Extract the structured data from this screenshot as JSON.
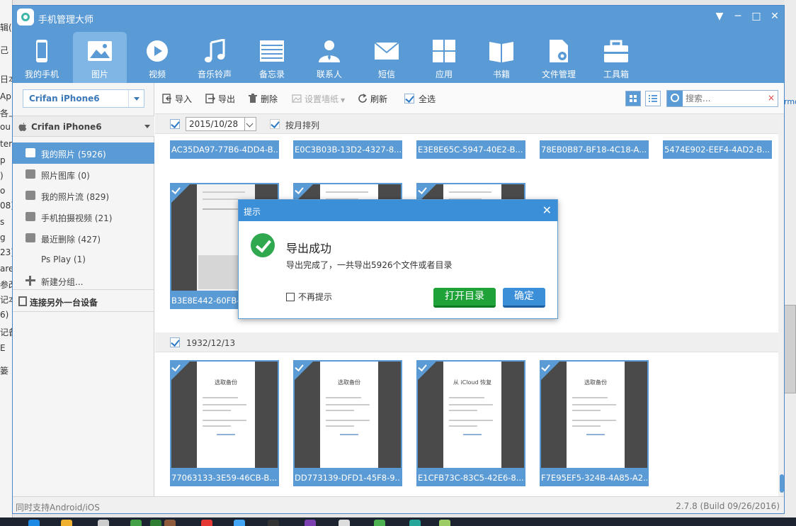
{
  "background": {
    "left_fragments": [
      "辑(",
      "己",
      "日本",
      "Ap",
      "各上",
      "ou",
      "ter",
      "p",
      ")",
      "o",
      "08)",
      "s",
      "g",
      "23)",
      "are",
      "参改",
      "记本",
      "6)",
      "记备",
      "E",
      "篓"
    ],
    "right_fragment": "rmo"
  },
  "titlebar": {
    "title": "手机管理大师",
    "menu_glyph": "▼",
    "minimize_glyph": "─",
    "maximize_glyph": "□",
    "close_glyph": "✕"
  },
  "nav": {
    "items": [
      {
        "label": "我的手机",
        "icon": "phone-icon"
      },
      {
        "label": "图片",
        "icon": "picture-icon"
      },
      {
        "label": "视频",
        "icon": "video-icon"
      },
      {
        "label": "音乐铃声",
        "icon": "music-icon"
      },
      {
        "label": "备忘录",
        "icon": "memo-icon"
      },
      {
        "label": "联系人",
        "icon": "contact-icon"
      },
      {
        "label": "短信",
        "icon": "message-icon"
      },
      {
        "label": "应用",
        "icon": "apps-icon"
      },
      {
        "label": "书籍",
        "icon": "book-icon"
      },
      {
        "label": "文件管理",
        "icon": "file-manager-icon"
      },
      {
        "label": "工具箱",
        "icon": "toolbox-icon"
      }
    ],
    "active_index": 1,
    "color": "#5b9bd5"
  },
  "sidebar": {
    "device_select_value": "Crifan iPhone6",
    "device_header": "Crifan iPhone6",
    "items": [
      {
        "label": "我的照片 (5926)",
        "icon": "photo-icon"
      },
      {
        "label": "照片图库 (0)",
        "icon": "gallery-icon"
      },
      {
        "label": "我的照片流 (829)",
        "icon": "cloud-icon"
      },
      {
        "label": "手机拍摄视频 (21)",
        "icon": "camera-video-icon"
      },
      {
        "label": "最近删除 (427)",
        "icon": "trash-icon"
      },
      {
        "label": "Ps Play (1)",
        "icon": ""
      },
      {
        "label": "新建分组...",
        "icon": "plus-icon"
      }
    ],
    "active_index": 0,
    "connect_other": "连接另外一台设备"
  },
  "content_toolbar": {
    "import_label": "导入",
    "export_label": "导出",
    "delete_label": "删除",
    "wallpaper_label": "设置墙纸",
    "refresh_label": "刷新",
    "select_all_label": "全选",
    "search_placeholder": "搜索...",
    "search_clear": "×"
  },
  "groups": [
    {
      "date": "2015/10/28",
      "sort_label": "按月排列",
      "top_strip": [
        "AC35DA97-77B6-4DD4-B...",
        "E0C3B03B-13D2-4327-8...",
        "E3E8E65C-5947-40E2-B...",
        "78EB0B87-BF18-4C18-A...",
        "5474E902-EEF4-4AD2-B..."
      ],
      "thumbs": [
        "B3E8E442-60FB-"
      ]
    },
    {
      "date": "1932/12/13",
      "thumbs": [
        {
          "label": "77063133-3E59-46CB-B...",
          "screen_title": "选取备份"
        },
        {
          "label": "DD773139-DFD1-45F8-9...",
          "screen_title": "选取备份"
        },
        {
          "label": "E1CFB73C-83C5-42E6-8...",
          "screen_title": "从 iCloud 恢复"
        },
        {
          "label": "F7E95EF5-324B-4A85-A2...",
          "screen_title": "选取备份"
        }
      ]
    }
  ],
  "statusbar": {
    "left": "同时支持Android/iOS",
    "right": "2.7.8 (Build 09/26/2016)"
  },
  "dialog": {
    "title": "提示",
    "close_glyph": "✕",
    "heading": "导出成功",
    "message": "导出完成了，一共导出5926个文件或者目录",
    "no_show_label": "不再提示",
    "open_dir_label": "打开目录",
    "ok_label": "确定"
  }
}
